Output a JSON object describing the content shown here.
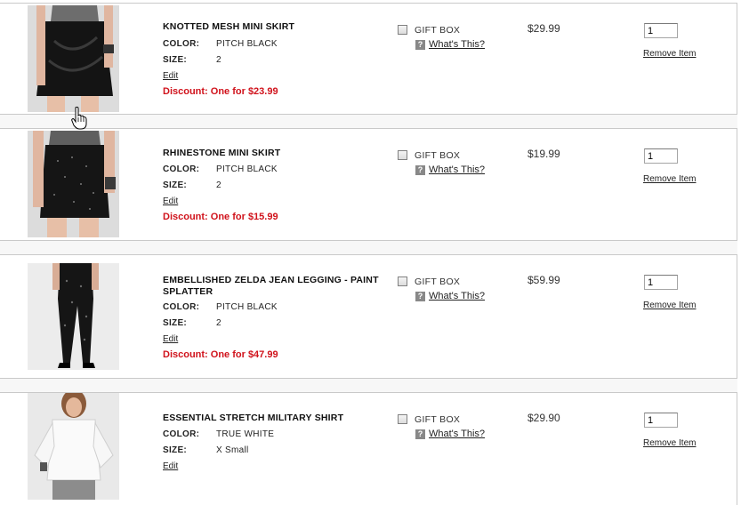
{
  "items": [
    {
      "name": "KNOTTED MESH MINI SKIRT",
      "color_label": "COLOR:",
      "color": "PITCH BLACK",
      "size_label": "SIZE:",
      "size": "2",
      "edit": "Edit",
      "discount": "Discount: One for $23.99",
      "gift_box": "GIFT BOX",
      "help": "?",
      "whats_this": "What's This?",
      "price": "$29.99",
      "qty": "1",
      "remove": "Remove Item",
      "image": "black-knotted-mini-skirt-photo"
    },
    {
      "name": "RHINESTONE MINI SKIRT",
      "color_label": "COLOR:",
      "color": "PITCH BLACK",
      "size_label": "SIZE:",
      "size": "2",
      "edit": "Edit",
      "discount": "Discount: One for $15.99",
      "gift_box": "GIFT BOX",
      "help": "?",
      "whats_this": "What's This?",
      "price": "$19.99",
      "qty": "1",
      "remove": "Remove Item",
      "image": "black-rhinestone-mini-skirt-photo"
    },
    {
      "name": "EMBELLISHED ZELDA JEAN LEGGING - PAINT SPLATTER",
      "color_label": "COLOR:",
      "color": "PITCH BLACK",
      "size_label": "SIZE:",
      "size": "2",
      "edit": "Edit",
      "discount": "Discount: One for $47.99",
      "gift_box": "GIFT BOX",
      "help": "?",
      "whats_this": "What's This?",
      "price": "$59.99",
      "qty": "1",
      "remove": "Remove Item",
      "image": "black-paint-splatter-legging-photo"
    },
    {
      "name": "ESSENTIAL STRETCH MILITARY SHIRT",
      "color_label": "COLOR:",
      "color": "TRUE WHITE",
      "size_label": "SIZE:",
      "size": "X Small",
      "edit": "Edit",
      "discount": "",
      "gift_box": "GIFT BOX",
      "help": "?",
      "whats_this": "What's This?",
      "price": "$29.90",
      "qty": "1",
      "remove": "Remove Item",
      "image": "white-military-shirt-photo"
    }
  ],
  "colors": {
    "discount": "#d0121b",
    "border": "#c9c9c9"
  },
  "cursor": "hand-pointer-icon"
}
